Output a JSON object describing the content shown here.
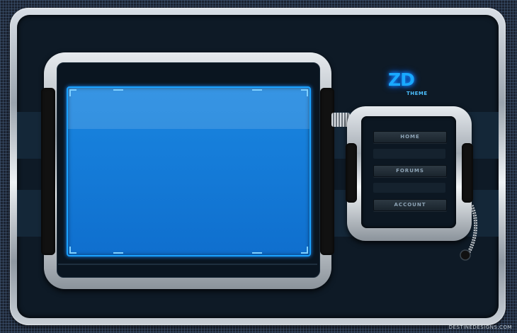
{
  "theme": {
    "accent": "#19a9ff",
    "screen_color": "#1177d8",
    "frame_color": "#0e1a26"
  },
  "logo": {
    "mark": "ZD",
    "subtitle": "THEME",
    "icon": "zd-logo-icon"
  },
  "nav": {
    "items": [
      {
        "label": "HOME"
      },
      {
        "label": "FORUMS"
      },
      {
        "label": "ACCOUNT"
      }
    ]
  },
  "footer": {
    "credit": "DESTINEDESIGNS.COM"
  }
}
